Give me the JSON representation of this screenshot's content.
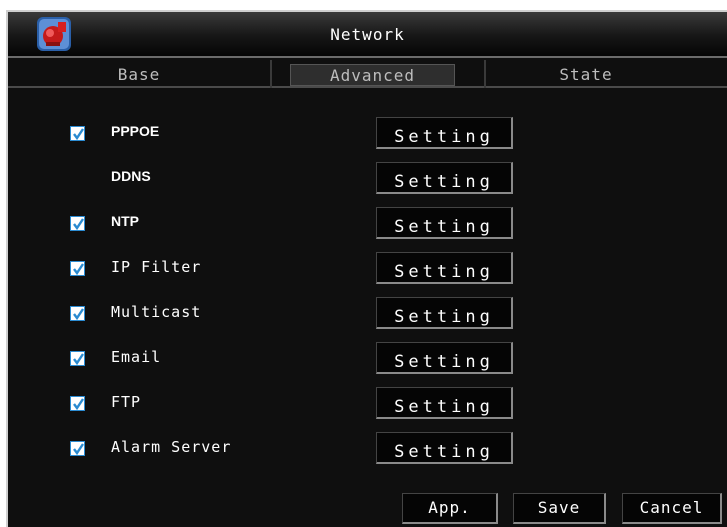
{
  "window": {
    "title": "Network"
  },
  "tabs": [
    {
      "label": "Base",
      "active": false
    },
    {
      "label": "Advanced",
      "active": true
    },
    {
      "label": "State",
      "active": false
    }
  ],
  "rows": [
    {
      "label": "PPPOE",
      "checked": true,
      "button": "Setting"
    },
    {
      "label": "DDNS",
      "checked": false,
      "button": "Setting"
    },
    {
      "label": "NTP",
      "checked": true,
      "button": "Setting"
    },
    {
      "label": "IP Filter",
      "checked": true,
      "button": "Setting"
    },
    {
      "label": "Multicast",
      "checked": true,
      "button": "Setting"
    },
    {
      "label": "Email",
      "checked": true,
      "button": "Setting"
    },
    {
      "label": "FTP",
      "checked": true,
      "button": "Setting"
    },
    {
      "label": "Alarm Server",
      "checked": true,
      "button": "Setting"
    }
  ],
  "footer": {
    "apply_label": "App.",
    "save_label": "Save",
    "cancel_label": "Cancel"
  },
  "colors": {
    "checkbox_border": "#2b8bd1",
    "check_mark": "#2b8bd1",
    "background": "#0f0f0f"
  },
  "icons": {
    "title_logo": "camera-logo-icon",
    "checkbox_mark": "check-icon"
  }
}
